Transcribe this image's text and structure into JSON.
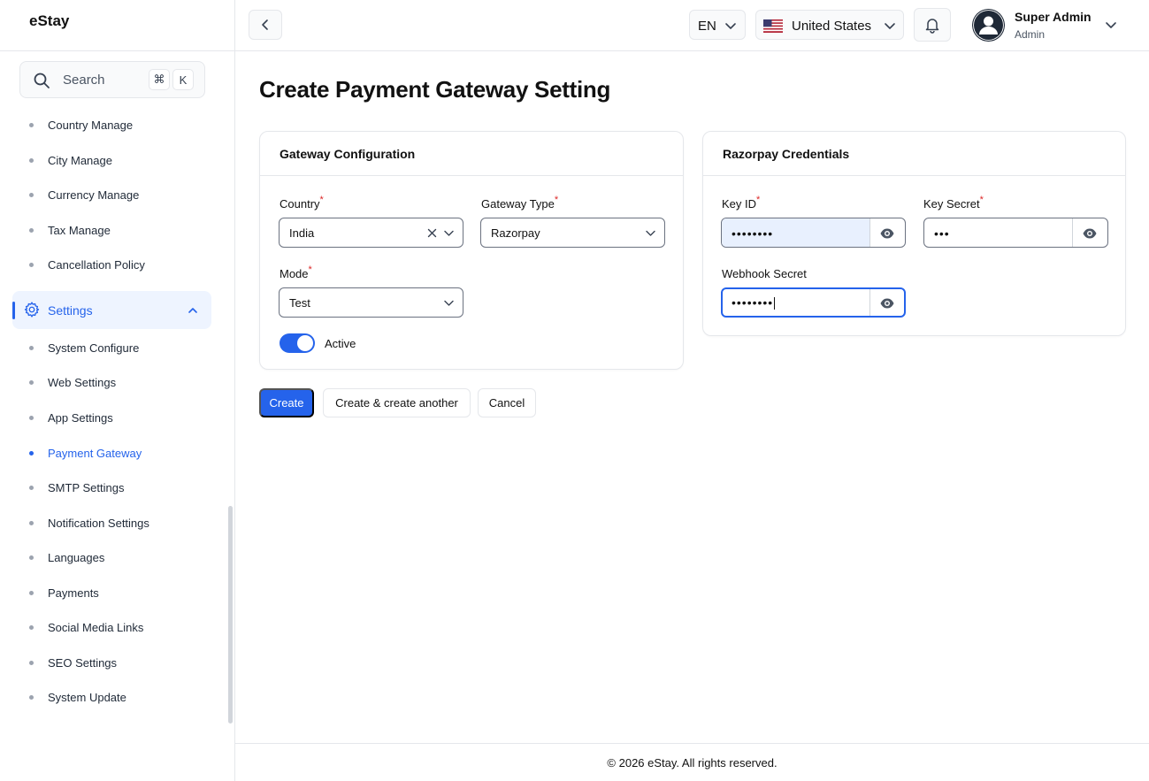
{
  "app": {
    "brand": "eStay"
  },
  "search": {
    "label": "Search",
    "shortcut_mod": "⌘",
    "shortcut_key": "K"
  },
  "sidebar": {
    "items_top": [
      {
        "label": "Country Manage"
      },
      {
        "label": "City Manage"
      },
      {
        "label": "Currency Manage"
      },
      {
        "label": "Tax Manage"
      },
      {
        "label": "Cancellation Policy"
      }
    ],
    "settings_group": {
      "label": "Settings",
      "expanded": true
    },
    "settings_items": [
      {
        "label": "System Configure"
      },
      {
        "label": "Web Settings"
      },
      {
        "label": "App Settings"
      },
      {
        "label": "Payment Gateway",
        "active": true
      },
      {
        "label": "SMTP Settings"
      },
      {
        "label": "Notification Settings"
      },
      {
        "label": "Languages"
      },
      {
        "label": "Payments"
      },
      {
        "label": "Social Media Links"
      },
      {
        "label": "SEO Settings"
      },
      {
        "label": "System Update"
      }
    ]
  },
  "topbar": {
    "language": "EN",
    "country": "United States",
    "user": {
      "name": "Super Admin",
      "role": "Admin"
    }
  },
  "page": {
    "title": "Create Payment Gateway Setting"
  },
  "gateway_card": {
    "title": "Gateway Configuration",
    "country": {
      "label": "Country",
      "value": "India"
    },
    "gateway_type": {
      "label": "Gateway Type",
      "value": "Razorpay"
    },
    "mode": {
      "label": "Mode",
      "value": "Test"
    },
    "active": {
      "label": "Active",
      "on": true
    }
  },
  "credentials_card": {
    "title": "Razorpay Credentials",
    "key_id": {
      "label": "Key ID",
      "masked": "••••••••"
    },
    "key_secret": {
      "label": "Key Secret",
      "masked": "•••"
    },
    "webhook_secret": {
      "label": "Webhook Secret",
      "masked": "••••••••"
    }
  },
  "actions": {
    "create": "Create",
    "create_another": "Create & create another",
    "cancel": "Cancel"
  },
  "footer": {
    "text": "© 2026 eStay. All rights reserved."
  },
  "colors": {
    "accent": "#2563eb",
    "required": "#dc2626",
    "border": "#e5e7eb"
  }
}
